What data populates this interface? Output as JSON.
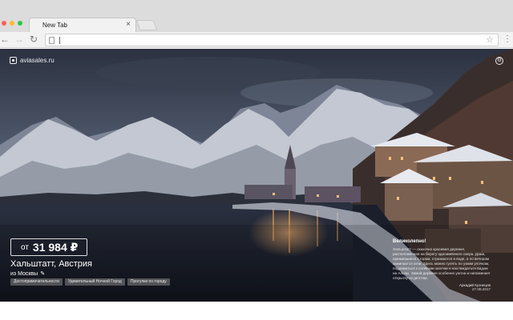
{
  "browser": {
    "tab_title": "New Tab",
    "tab_close": "×",
    "icons": {
      "back": "back-arrow-icon",
      "forward": "forward-arrow-icon",
      "reload": "reload-icon",
      "page": "page-icon",
      "bookmark": "star-icon",
      "menu": "menu-dots-icon"
    }
  },
  "page": {
    "logo_text": "aviasales.ru",
    "price_prefix": "от",
    "price_value": "31 984 ₽",
    "destination": "Хальштатт, Австрия",
    "origin": "из Москвы",
    "tags": [
      "Достопримечательности",
      "Удивительный Ночной Город",
      "Прогулки по городу"
    ],
    "description": {
      "title": "Великолепно!",
      "text": "Хальштатт — сказочно красивая деревня, расположенная на берегу одноимённого озера. Дома, прижавшиеся к горам, отражаются в воде, а по вечерам зажигаются огни. Здесь можно гулять по узким улочкам, подниматься к соляным шахтам и наслаждаться видом на Альпы. Зимой деревня особенно уютна и напоминает открытку из детства.",
      "author": "Аркадий Кузнецов",
      "date": "27.08.2017"
    }
  },
  "colors": {
    "sky": "#4a5468",
    "mountain_snow": "#c9ced8",
    "water": "#1a1f2b",
    "lights": "#e8a05a"
  }
}
